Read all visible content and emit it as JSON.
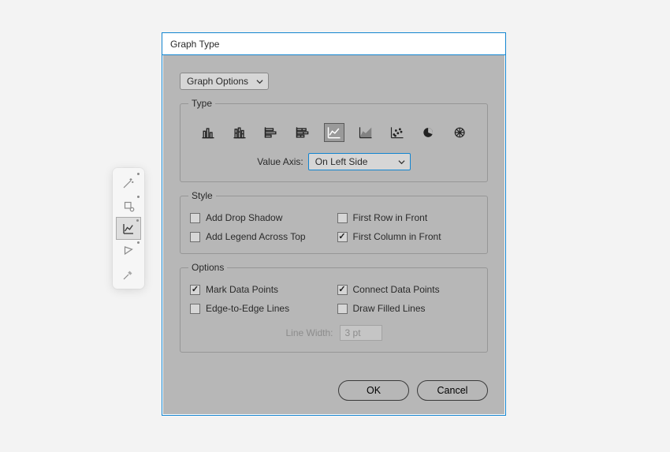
{
  "dialog": {
    "title": "Graph Type",
    "dropdown": "Graph Options",
    "section_type": {
      "legend": "Type",
      "value_axis_label": "Value Axis:",
      "value_axis_value": "On Left Side"
    },
    "section_style": {
      "legend": "Style",
      "add_drop_shadow": "Add Drop Shadow",
      "first_row_front": "First Row in Front",
      "add_legend_top": "Add Legend Across Top",
      "first_col_front": "First Column in Front"
    },
    "section_options": {
      "legend": "Options",
      "mark_data_points": "Mark Data Points",
      "connect_data_points": "Connect Data Points",
      "edge_to_edge": "Edge-to-Edge Lines",
      "draw_filled": "Draw Filled Lines",
      "line_width_label": "Line Width:",
      "line_width_value": "3 pt"
    },
    "buttons": {
      "ok": "OK",
      "cancel": "Cancel"
    }
  }
}
